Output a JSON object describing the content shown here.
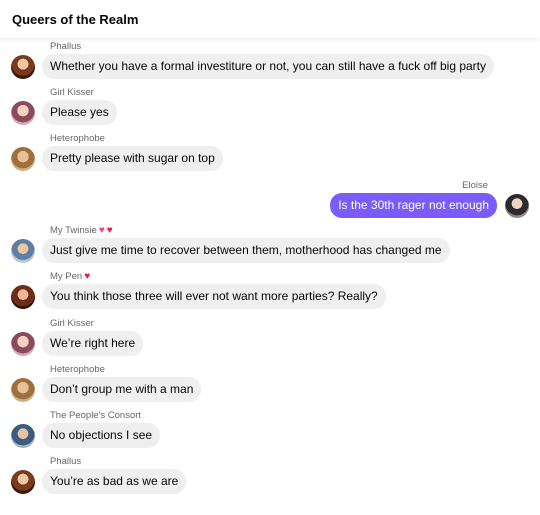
{
  "header": {
    "title": "Queers of the Realm"
  },
  "messages": [
    {
      "sender": "Phallus",
      "text": "Whether you have a formal investiture or not, you can still have a fuck off big party"
    },
    {
      "sender": "Girl Kisser",
      "text": "Please yes"
    },
    {
      "sender": "Heterophobe",
      "text": "Pretty please with sugar on top"
    },
    {
      "sender": "Eloise",
      "text": "Is the 30th rager not enough",
      "outgoing": true
    },
    {
      "sender": "My Twinsie",
      "text": "Just give me time to recover between them, motherhood has changed me"
    },
    {
      "sender": "My Pen",
      "text": "You think those three will ever not want more parties? Really?"
    },
    {
      "sender": "Girl Kisser",
      "text": "We’re right here"
    },
    {
      "sender": "Heterophobe",
      "text": "Don’t group me with a man"
    },
    {
      "sender": "The People's Consort",
      "text": "No objections I see"
    },
    {
      "sender": "Phallus",
      "text": "You’re as bad as we are"
    }
  ],
  "colors": {
    "outgoing_bubble": "#7b5cfa",
    "incoming_bubble": "#efefef"
  }
}
